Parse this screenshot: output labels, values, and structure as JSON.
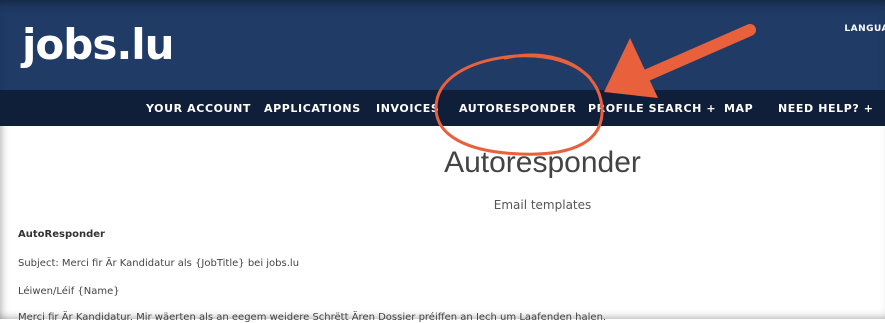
{
  "header": {
    "logo": "jobs.lu",
    "language_label": "LANGUA"
  },
  "nav": {
    "items": [
      {
        "label": "YOUR ACCOUNT"
      },
      {
        "label": "APPLICATIONS"
      },
      {
        "label": "INVOICES"
      },
      {
        "label": "AUTORESPONDER"
      },
      {
        "label": "PROFILE SEARCH +"
      },
      {
        "label": "MAP"
      },
      {
        "label": "NEED HELP? +"
      }
    ]
  },
  "main": {
    "title": "Autoresponder",
    "subtitle": "Email templates",
    "section_heading": "AutoResponder",
    "lines": [
      "Subject: Merci fir Är Kandidatur als {JobTitle} bei jobs.lu",
      "Léiwen/Léif {Name}",
      "Merci fir Är Kandidatur. Mir wäerten als an eegem weidere Schrëtt Ären Dossier préiffen an Iech um Laafenden halen."
    ]
  },
  "annotations": {
    "highlight_color": "#e8603c",
    "arrow_icon": "arrow-left-down-icon",
    "circle_icon": "hand-drawn-circle-icon"
  }
}
